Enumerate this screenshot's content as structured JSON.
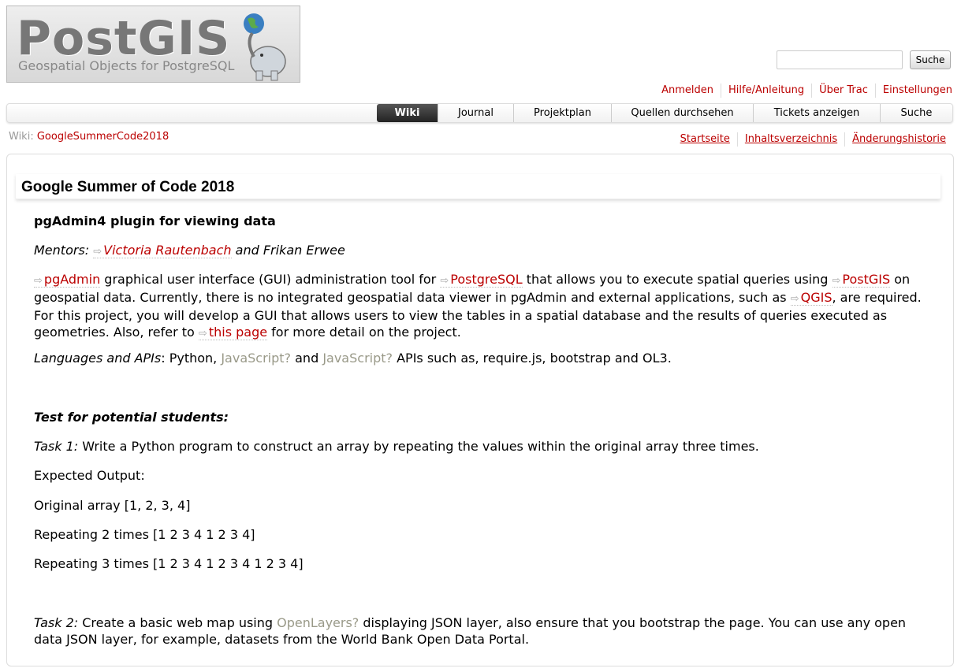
{
  "logo": {
    "title": "PostGIS",
    "subtitle": "Geospatial Objects for PostgreSQL"
  },
  "search": {
    "placeholder": "",
    "button_label": "Suche"
  },
  "metanav": [
    "Anmelden",
    "Hilfe/Anleitung",
    "Über Trac",
    "Einstellungen"
  ],
  "mainnav": [
    {
      "label": "Wiki",
      "active": true
    },
    {
      "label": "Journal"
    },
    {
      "label": "Projektplan"
    },
    {
      "label": "Quellen durchsehen"
    },
    {
      "label": "Tickets anzeigen"
    },
    {
      "label": "Suche"
    }
  ],
  "path": {
    "prefix": "Wiki:",
    "page": "GoogleSummerCode2018"
  },
  "ctxtnav": [
    "Startseite",
    "Inhaltsverzeichnis",
    "Änderungshistorie"
  ],
  "page": {
    "title": "Google Summer of Code 2018",
    "subtitle": "pgAdmin4 plugin for viewing data",
    "mentors_label": "Mentors:",
    "mentor1": "Victoria Rautenbach",
    "mentors_and": "and Frikan Erwee",
    "p1_link1": "pgAdmin",
    "p1_t1": " graphical user interface (GUI) administration tool for ",
    "p1_link2": "PostgreSQL",
    "p1_t2": " that allows you to execute spatial queries using ",
    "p1_link3": "PostGIS",
    "p1_t3": " on geospatial data. Currently, there is no integrated geospatial data viewer in pgAdmin and external applications, such as ",
    "p1_link4": "QGIS",
    "p1_t4": ", are required. For this project, you will develop a GUI that allows users to view the tables in a spatial database and the results of queries executed as geometries. Also, refer to ",
    "p1_link5": "this page",
    "p1_t5": " for more detail on the project.",
    "lang_label": "Languages and APIs",
    "lang_t1": ": Python, ",
    "lang_missing1": "JavaScript?",
    "lang_t2": " and ",
    "lang_missing2": "JavaScript?",
    "lang_t3": " APIs such as, require.js, bootstrap and OL3.",
    "test_heading": "Test for potential students:",
    "task1_label": "Task 1:",
    "task1_text": " Write a Python program to construct an array by repeating the values within the original array three times.",
    "expected": "Expected Output:",
    "original": "Original array [1, 2, 3, 4]",
    "repeat2": "Repeating 2 times [1 2 3 4 1 2 3 4]",
    "repeat3": "Repeating 3 times [1 2 3 4 1 2 3 4 1 2 3 4]",
    "task2_label": "Task 2:",
    "task2_t1": " Create a basic web map using ",
    "task2_missing": "OpenLayers?",
    "task2_t2": " displaying JSON layer, also ensure that you bootstrap the page. You can use any open data JSON layer, for example, datasets from the World Bank Open Data Portal."
  }
}
